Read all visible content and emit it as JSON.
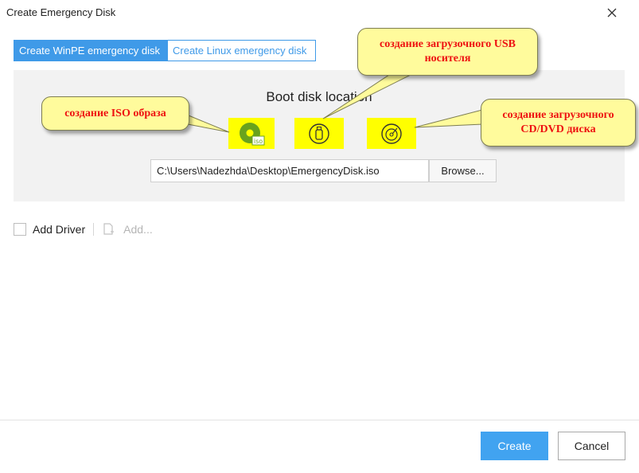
{
  "window": {
    "title": "Create Emergency Disk",
    "close_icon": "close-icon"
  },
  "tabs": [
    {
      "label": "Create WinPE emergency disk",
      "active": true
    },
    {
      "label": "Create Linux emergency disk",
      "active": false
    }
  ],
  "panel": {
    "heading": "Boot disk location",
    "icons": [
      {
        "name": "iso-disc-icon",
        "badge": "iso"
      },
      {
        "name": "usb-drive-icon"
      },
      {
        "name": "cd-dvd-disc-icon"
      }
    ],
    "path_value": "C:\\Users\\Nadezhda\\Desktop\\EmergencyDisk.iso",
    "browse_label": "Browse..."
  },
  "driver": {
    "checkbox_label": "Add Driver",
    "checked": false,
    "add_label": "Add..."
  },
  "footer": {
    "create_label": "Create",
    "cancel_label": "Cancel"
  },
  "annotations": {
    "iso": "создание ISO образа",
    "usb_line1": "создание загрузочного USB",
    "usb_line2": "носителя",
    "cd_line1": "создание загрузочного",
    "cd_line2": "CD/DVD диска"
  },
  "colors": {
    "accent": "#3f9ae8",
    "create_button": "#41a3f0",
    "icon_highlight": "#ffff00",
    "iso_icon_green": "#6aa21d",
    "callout_fill": "#fffb9c",
    "callout_text": "#ee1111"
  }
}
